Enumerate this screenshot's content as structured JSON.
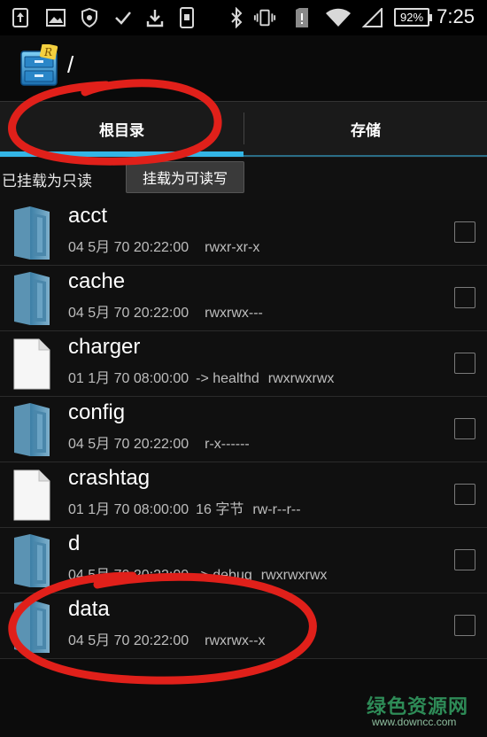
{
  "status_bar": {
    "icons": [
      "upload-icon",
      "image-icon",
      "shield-icon",
      "check-icon",
      "download-icon",
      "phone-icon",
      "bluetooth-icon",
      "vibrate-icon",
      "sim-icon",
      "wifi-icon",
      "signal-icon"
    ],
    "battery": "92%",
    "battery_level": 0.92,
    "time": "7:25"
  },
  "title_bar": {
    "app_icon": "root-explorer-icon",
    "path": "/"
  },
  "tabs": [
    {
      "label": "根目录",
      "active": true
    },
    {
      "label": "存储",
      "active": false
    }
  ],
  "mount": {
    "status_text": "已挂载为只读",
    "button_label": "挂载为可读写"
  },
  "files": [
    {
      "name": "acct",
      "type": "folder",
      "date": "04 5月 70 20:22:00",
      "extra": "",
      "perms": "rwxr-xr-x"
    },
    {
      "name": "cache",
      "type": "folder",
      "date": "04 5月 70 20:22:00",
      "extra": "",
      "perms": "rwxrwx---"
    },
    {
      "name": "charger",
      "type": "file",
      "date": "01 1月 70 08:00:00",
      "extra": "-> healthd",
      "perms": "rwxrwxrwx"
    },
    {
      "name": "config",
      "type": "folder",
      "date": "04 5月 70 20:22:00",
      "extra": "",
      "perms": "r-x------"
    },
    {
      "name": "crashtag",
      "type": "file",
      "date": "01 1月 70 08:00:00",
      "extra": "16 字节",
      "perms": "rw-r--r--"
    },
    {
      "name": "d",
      "type": "folder",
      "date": "04 5月 70 20:22:00",
      "extra": "-> debug",
      "perms": "rwxrwxrwx"
    },
    {
      "name": "data",
      "type": "folder",
      "date": "04 5月 70 20:22:00",
      "extra": "",
      "perms": "rwxrwx--x"
    }
  ],
  "watermark": {
    "main": "绿色资源网",
    "sub": "www.downcc.com"
  },
  "colors": {
    "accent": "#33b5e5",
    "annotation": "#e0201a",
    "watermark": "#2e8b57"
  }
}
